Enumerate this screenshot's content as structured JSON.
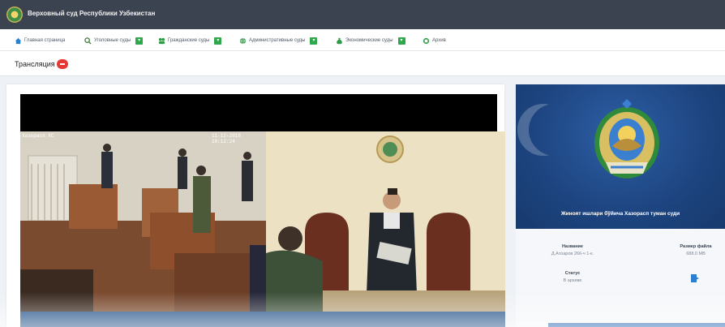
{
  "header": {
    "title": "Верховный суд Республики Узбекистан"
  },
  "nav": {
    "items": [
      {
        "label": "Главная страница",
        "icon": "home-icon",
        "badge": false
      },
      {
        "label": "Уголовные суды",
        "icon": "search-people-icon",
        "badge": true
      },
      {
        "label": "Гражданские суды",
        "icon": "people-icon",
        "badge": true
      },
      {
        "label": "Административные суды",
        "icon": "globe-icon",
        "badge": true
      },
      {
        "label": "Экономические суды",
        "icon": "money-bag-icon",
        "badge": true
      },
      {
        "label": "Архив",
        "icon": "archive-icon",
        "badge": false
      }
    ],
    "badge_symbol": "▾"
  },
  "breadcrumb": {
    "label": "Трансляция"
  },
  "video": {
    "osd_left": "Хазорасп ХС",
    "osd_right": "11-12-2018 10:12:24"
  },
  "side": {
    "banner_caption": "Жиноят ишлари бўйича Хазорасп туман суди",
    "name_label": "Название",
    "name_value": "Д.Атоаров 266-ч 1-к.",
    "size_label": "Размер файла",
    "size_value": "688.0 MB",
    "status_label": "Статус",
    "status_value": "В архиве"
  },
  "colors": {
    "topbar": "#3b4250",
    "accent_green": "#2ea84a",
    "live_red": "#e53935",
    "banner_blue": "#1d447f"
  }
}
